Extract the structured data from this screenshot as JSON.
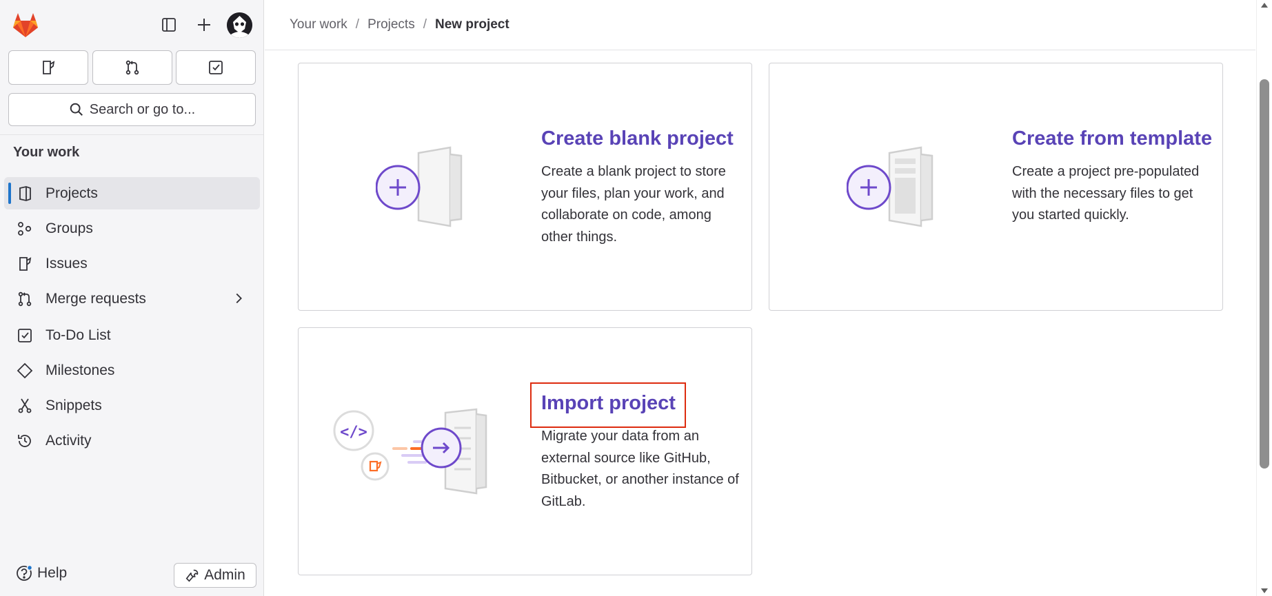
{
  "sidebar": {
    "search_placeholder": "Search or go to...",
    "section_title": "Your work",
    "items": [
      {
        "label": "Projects",
        "icon": "project-icon",
        "active": true
      },
      {
        "label": "Groups",
        "icon": "group-icon"
      },
      {
        "label": "Issues",
        "icon": "issues-icon"
      },
      {
        "label": "Merge requests",
        "icon": "merge-request-icon"
      },
      {
        "label": "To-Do List",
        "icon": "todo-icon"
      },
      {
        "label": "Milestones",
        "icon": "milestone-icon"
      },
      {
        "label": "Snippets",
        "icon": "snippet-icon"
      },
      {
        "label": "Activity",
        "icon": "history-icon"
      }
    ],
    "help_label": "Help",
    "admin_label": "Admin"
  },
  "breadcrumb": {
    "items": [
      "Your work",
      "Projects"
    ],
    "current": "New project",
    "separator": "/"
  },
  "cards": [
    {
      "title": "Create blank project",
      "description": "Create a blank project to store your files, plan your work, and collaborate on code, among other things."
    },
    {
      "title": "Create from template",
      "description": "Create a project pre-populated with the necessary files to get you started quickly."
    },
    {
      "title": "Import project",
      "description": "Migrate your data from an external source like GitHub, Bitbucket, or another instance of GitLab."
    }
  ],
  "colors": {
    "accent_purple": "#5943b6",
    "active_indicator": "#1f75cb",
    "highlight_red": "#dd2b0e",
    "gitlab_orange": "#fc6d26"
  }
}
